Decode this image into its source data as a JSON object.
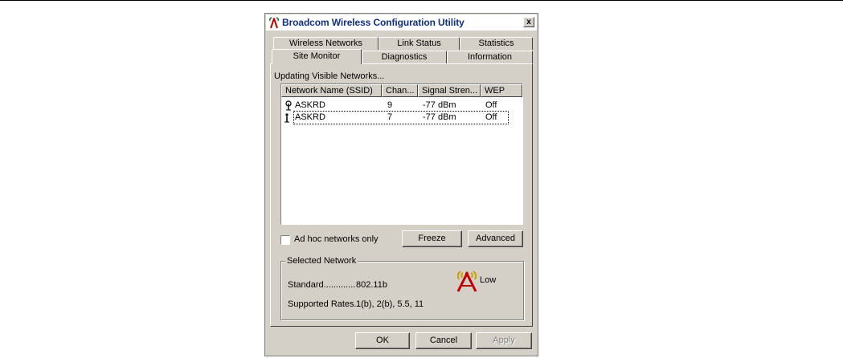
{
  "window": {
    "title": "Broadcom Wireless Configuration Utility",
    "close_label": "x"
  },
  "tabs_back": [
    {
      "label": "Wireless Networks"
    },
    {
      "label": "Link Status"
    },
    {
      "label": "Statistics"
    }
  ],
  "tabs_front": [
    {
      "label": "Site Monitor",
      "active": true
    },
    {
      "label": "Diagnostics"
    },
    {
      "label": "Information"
    }
  ],
  "site_monitor": {
    "status_text": "Updating Visible Networks...",
    "columns": [
      "Network Name (SSID)",
      "Chan...",
      "Signal Stren...",
      "WEP"
    ],
    "rows": [
      {
        "icon": "access-point-icon",
        "ssid": "ASKRD",
        "channel": "9",
        "signal": "-77 dBm",
        "wep": "Off"
      },
      {
        "icon": "ad-hoc-icon",
        "ssid": "ASKRD",
        "channel": "7",
        "signal": "-77 dBm",
        "wep": "Off"
      }
    ],
    "adhoc_checkbox_label": "Ad hoc networks only",
    "adhoc_checked": false,
    "freeze_label": "Freeze",
    "advanced_label": "Advanced"
  },
  "selected_network": {
    "group_label": "Selected Network",
    "standard_label": "Standard.............",
    "standard_value": "802.11b",
    "rates_label": "Supported Rates..",
    "rates_value": "1(b), 2(b), 5.5, 11",
    "signal_text": "Low",
    "signal_icon": "signal-strength-icon"
  },
  "dialog_buttons": {
    "ok": "OK",
    "cancel": "Cancel",
    "apply": "Apply"
  },
  "colors": {
    "face": "#d4d0c8",
    "title_text": "#103080",
    "signal_red": "#c00000",
    "signal_gold": "#c8a000"
  }
}
